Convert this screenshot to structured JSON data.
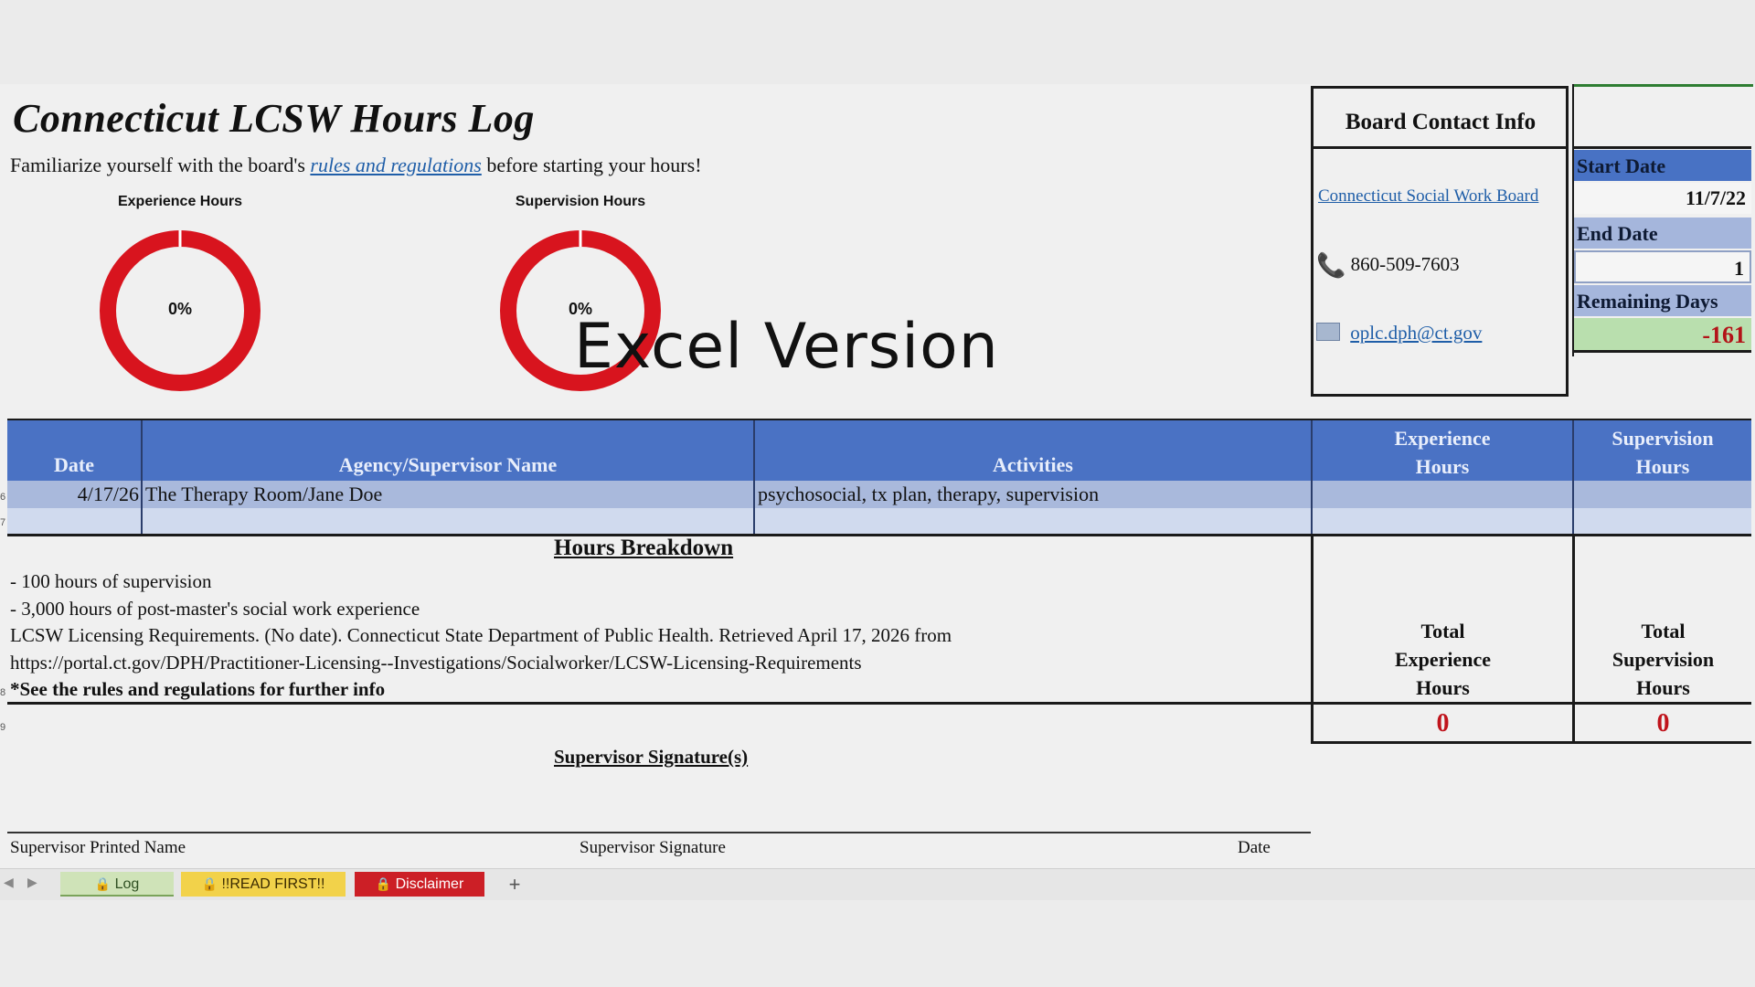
{
  "title": "Connecticut LCSW Hours Log",
  "subtitle": {
    "before": "Familiarize yourself with the board's",
    "link": "rules and regulations",
    "after": "before starting your hours!"
  },
  "gauges": [
    {
      "label": "Experience Hours",
      "percent_text": "0%",
      "percent": 0,
      "color": "#d8141e"
    },
    {
      "label": "Supervision Hours",
      "percent_text": "0%",
      "percent": 0,
      "color": "#d8141e"
    }
  ],
  "overlay_text": "Excel Version",
  "board": {
    "title": "Board Contact Info",
    "link": "Connecticut Social Work Board",
    "phone": "860-509-7603",
    "email": "oplc.dph@ct.gov",
    "phone_icon": "phone-icon",
    "email_icon": "email-icon"
  },
  "panel": {
    "start_label": "Start Date",
    "start_value": "11/7/22",
    "end_label": "End Date",
    "end_value": "1",
    "remaining_label": "Remaining Days",
    "remaining_value": "-161"
  },
  "table": {
    "headers": {
      "date": "Date",
      "agency": "Agency/Supervisor Name",
      "activities": "Activities",
      "exp1": "Experience",
      "exp2": "Hours",
      "sup1": "Supervision",
      "sup2": "Hours"
    },
    "rows": [
      {
        "date": "4/17/26",
        "agency": "The Therapy Room/Jane Doe",
        "activities": "psychosocial, tx plan, therapy, supervision",
        "exp": "",
        "sup": ""
      }
    ]
  },
  "breakdown": {
    "title": "Hours Breakdown",
    "lines": [
      "- 100 hours of supervision",
      "- 3,000 hours of post-master's social work experience",
      "LCSW Licensing Requirements. (No date). Connecticut State Department of Public Health. Retrieved April 17, 2026 from",
      "https://portal.ct.gov/DPH/Practitioner-Licensing--Investigations/Socialworker/LCSW-Licensing-Requirements",
      "*See the rules and regulations for further info"
    ]
  },
  "totals": {
    "exp_label": [
      "Total",
      "Experience",
      "Hours"
    ],
    "sup_label": [
      "Total",
      "Supervision",
      "Hours"
    ],
    "exp_value": "0",
    "sup_value": "0"
  },
  "signature": {
    "title": "Supervisor Signature(s)",
    "printed_name": "Supervisor Printed Name",
    "signature": "Supervisor Signature",
    "date": "Date"
  },
  "tabs": [
    {
      "label": "Log",
      "bg": "#cfe3b8",
      "fg": "#2f4f22"
    },
    {
      "label": "!!READ FIRST!!",
      "bg": "#f2d24a",
      "fg": "#3a2a00"
    },
    {
      "label": "Disclaimer",
      "bg": "#cc1f26",
      "fg": "#ffffff"
    }
  ],
  "add_sheet": "+"
}
